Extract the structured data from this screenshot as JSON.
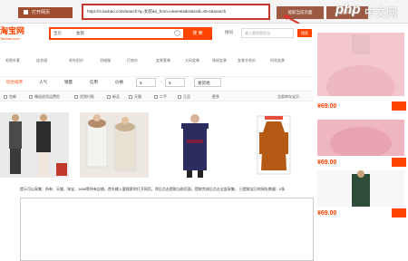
{
  "toolbar": {
    "left_label": "打开网页",
    "url": "https://s.taobao.com/search?q=女装&s_from=newHeader&ssid=s5-e&search",
    "collect_label": "提取当前页面",
    "collect2_label": "全部采集"
  },
  "watermark": {
    "php": "php",
    "cn": "中文网"
  },
  "header": {
    "logo": "淘宝网",
    "logo_sub": "Taobao.com",
    "search_category": "宝贝",
    "search_query": "女装",
    "search_button": "搜 索",
    "right_label": "搜同",
    "right_input_placeholder": "输入要搜索的宝",
    "right_button": "搜索"
  },
  "categories": [
    "毛呢外套",
    "连衣裙",
    "毛针织衫",
    "羽绒服",
    "打底衫",
    "女装套装",
    "大码女装",
    "休闲女装",
    "女装羊毛衫",
    "时尚女装"
  ],
  "filters": [
    "综合排序",
    "人气",
    "销量",
    "信用",
    "价格",
    "¥",
    "-",
    "¥",
    "发货地"
  ],
  "filter2": {
    "items": [
      "包邮",
      "赠送退货运费险",
      "货到付款",
      "新品",
      "天猫",
      "二手",
      "正品"
    ],
    "more": "更多",
    "right": "全部库存宝贝"
  },
  "status_text": "提示可以采集：所有、天猫、淘宝、1688等所有店铺，首先输入要搜索的打开网页，然后点击提取当前页面，提取完成后点击全部采集，  已提取宝贝的网址数量：0条",
  "right_col": {
    "price1": "¥69.00",
    "price2": "¥69.00",
    "price3": "¥69.00"
  },
  "colors": {
    "accent": "#ff4400",
    "tool_btn": "#9c5a43",
    "highlight": "#c0392b"
  }
}
